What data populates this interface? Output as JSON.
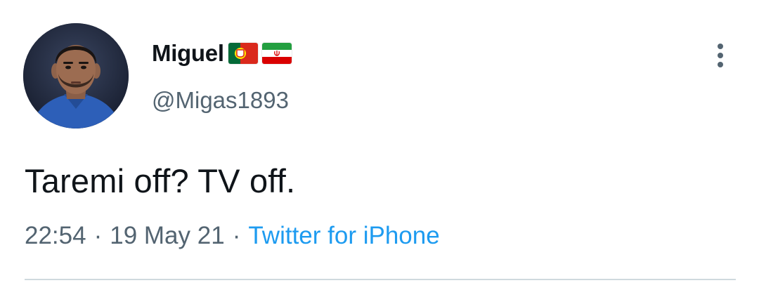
{
  "tweet": {
    "author": {
      "display_name": "Miguel",
      "handle": "@Migas1893",
      "flags": [
        "portugal-flag-icon",
        "iran-flag-icon"
      ]
    },
    "text": "Taremi off? TV off.",
    "time": "22:54",
    "date": "19 May 21",
    "separator": "·",
    "source": "Twitter for iPhone"
  },
  "colors": {
    "text": "#0f1419",
    "secondary": "#536471",
    "link": "#1d9bf0",
    "divider": "#cfd9de"
  },
  "icons": {
    "more": "vertical-ellipsis-icon"
  }
}
